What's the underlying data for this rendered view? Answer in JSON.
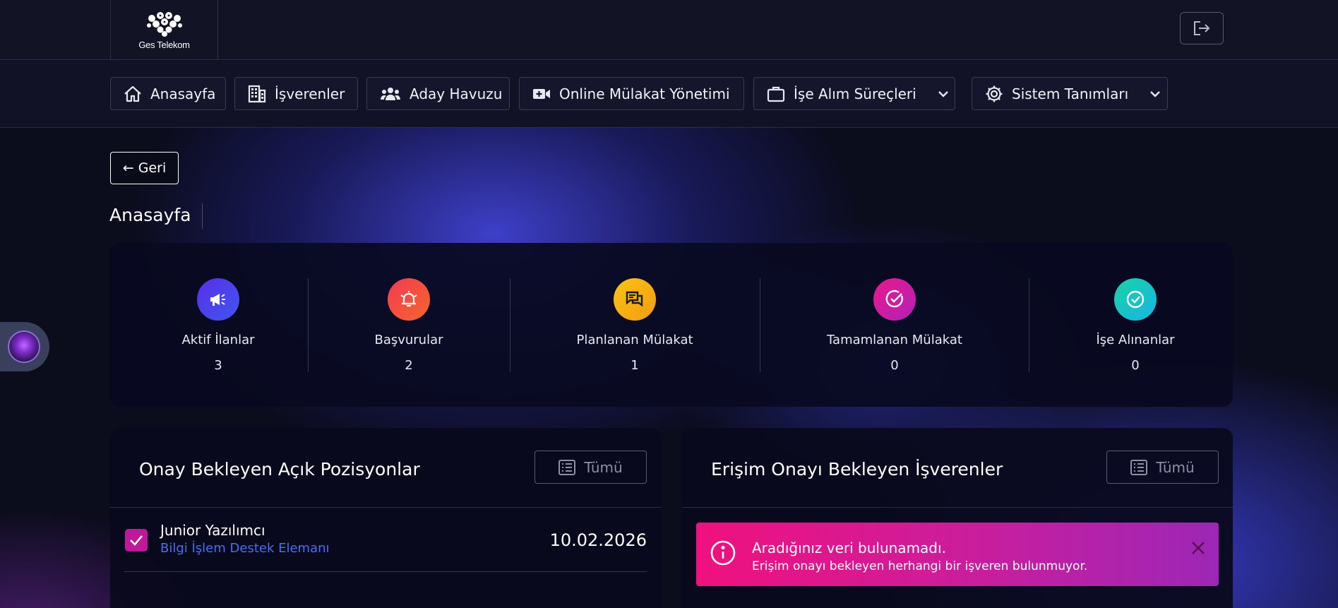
{
  "brand": {
    "logo_text": "Ges Telekom"
  },
  "header": {
    "logout_icon": "logout-icon"
  },
  "nav": {
    "items": [
      {
        "label": "Anasayfa",
        "icon": "home-icon"
      },
      {
        "label": "İşverenler",
        "icon": "building-icon"
      },
      {
        "label": "Aday Havuzu",
        "icon": "users-icon"
      },
      {
        "label": "Online Mülakat Yönetimi",
        "icon": "video-icon"
      },
      {
        "label": "İşe Alım Süreçleri",
        "icon": "briefcase-icon"
      },
      {
        "label": "Sistem Tanımları",
        "icon": "gear-icon"
      }
    ]
  },
  "page": {
    "back_label": "← Geri",
    "title": "Anasayfa"
  },
  "stats": [
    {
      "label": "Aktif İlanlar",
      "value": "3",
      "icon": "megaphone-icon",
      "color": "#4b3fe0"
    },
    {
      "label": "Başvurular",
      "value": "2",
      "icon": "bell-alert-icon",
      "color": "#f04a3a"
    },
    {
      "label": "Planlanan Mülakat",
      "value": "1",
      "icon": "chat-icon",
      "color": "#f6b311"
    },
    {
      "label": "Tamamlanan Mülakat",
      "value": "0",
      "icon": "check-badge-icon",
      "color": "#d01ca0"
    },
    {
      "label": "İşe Alınanlar",
      "value": "0",
      "icon": "check-circle-icon",
      "color": "#1ec8b0"
    }
  ],
  "panels": {
    "positions": {
      "title": "Onay Bekleyen Açık Pozisyonlar",
      "all_label": "Tümü",
      "rows": [
        {
          "title": "Junior Yazılımcı",
          "subtitle": "Bilgi İşlem Destek Elemanı",
          "date": "10.02.2026"
        }
      ]
    },
    "employers": {
      "title": "Erişim Onayı Bekleyen İşverenler",
      "all_label": "Tümü",
      "alert": {
        "title": "Aradığınız veri bulunamadı.",
        "message": "Erişim onayı bekleyen herhangi bir işveren bulunmuyor."
      }
    }
  }
}
